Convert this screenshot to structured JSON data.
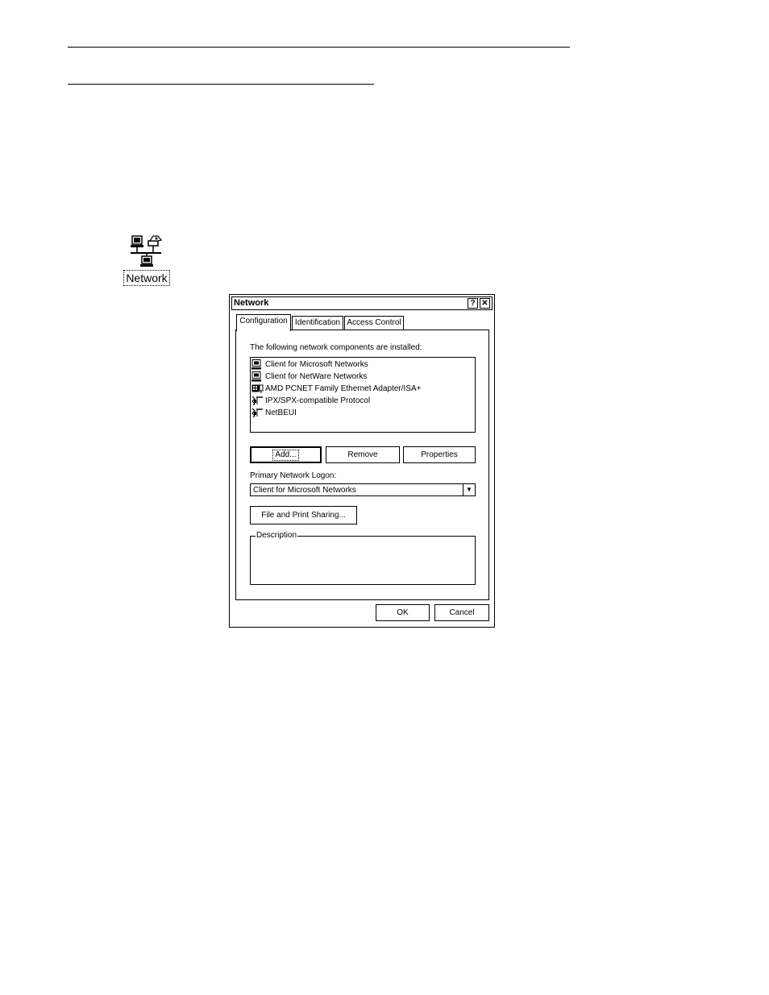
{
  "desktop": {
    "icon_label": "Network"
  },
  "dialog": {
    "title": "Network",
    "help_glyph": "?",
    "close_glyph": "✕",
    "tabs": [
      {
        "label": "Configuration",
        "active": true
      },
      {
        "label": "Identification",
        "active": false
      },
      {
        "label": "Access Control",
        "active": false
      }
    ],
    "components_label": "The following network components are installed:",
    "components": [
      {
        "label": "Client for Microsoft Networks",
        "icon": "client-computer-icon"
      },
      {
        "label": "Client for NetWare Networks",
        "icon": "client-computer-icon"
      },
      {
        "label": "AMD PCNET Family Ethernet Adapter/ISA+",
        "icon": "network-adapter-icon"
      },
      {
        "label": "IPX/SPX-compatible Protocol",
        "icon": "protocol-icon"
      },
      {
        "label": "NetBEUI",
        "icon": "protocol-icon"
      }
    ],
    "buttons": {
      "add": "Add...",
      "remove": "Remove",
      "properties": "Properties",
      "file_print": "File and Print Sharing...",
      "ok": "OK",
      "cancel": "Cancel"
    },
    "logon_label": "Primary Network Logon:",
    "logon_value": "Client for Microsoft Networks",
    "description_legend": "Description"
  }
}
